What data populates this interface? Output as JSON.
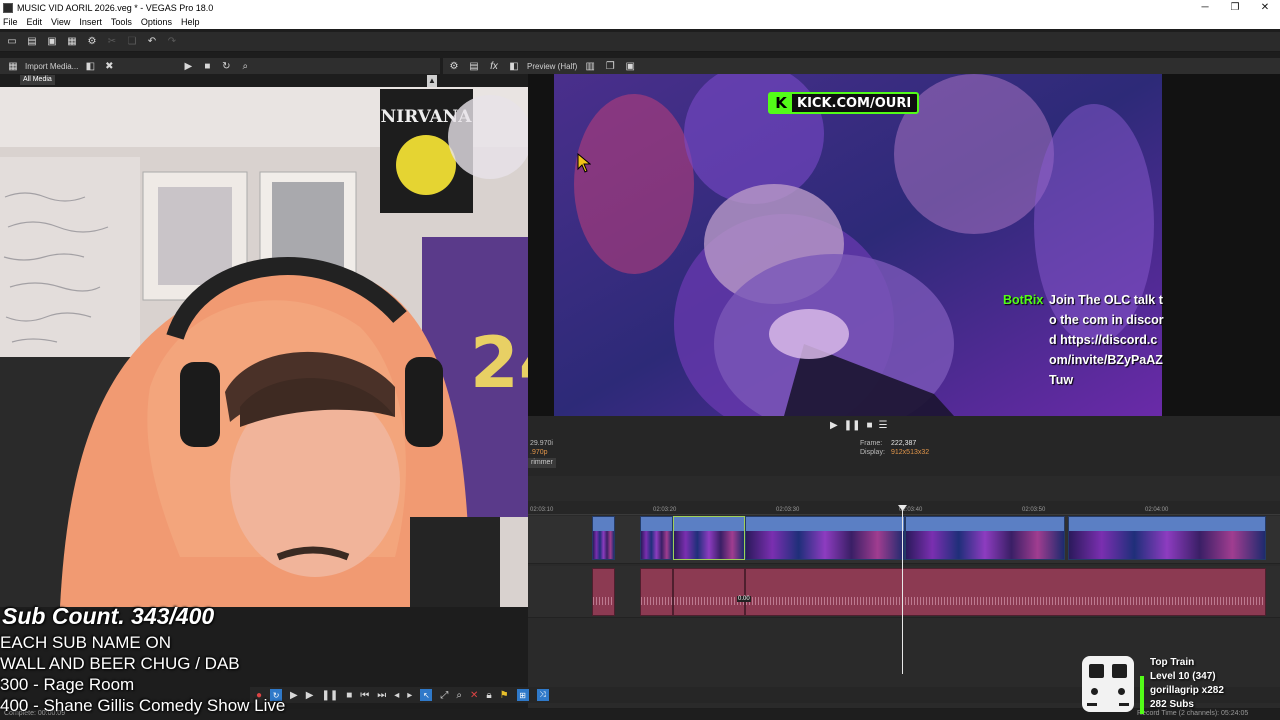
{
  "window": {
    "title": "MUSIC VID AORIL 2026.veg * - VEGAS Pro 18.0",
    "minimize": "─",
    "maximize": "❐",
    "close": "✕"
  },
  "menu": [
    "File",
    "Edit",
    "View",
    "Insert",
    "Tools",
    "Options",
    "Help"
  ],
  "media_panel": {
    "import_label": "Import Media...",
    "tree_item": "All Media"
  },
  "preview": {
    "quality": "Preview (Half)",
    "kick_logo": "K",
    "kick_text": "KICK.COM/OURI",
    "chat_user": "BotRix",
    "chat_message": "Join The OLC talk to the com in discord https://discord.com/invite/BZyPaAZTuw"
  },
  "preview_info": {
    "left_val_1": "29.970i",
    "left_val_2": ".970p",
    "frame_label": "Frame:",
    "frame_value": "222,387",
    "display_label": "Display:",
    "display_value": "912x513x32",
    "trimmer_tab": "rimmer"
  },
  "timeline": {
    "ticks": [
      "02:03:10",
      "02:03:20",
      "02:03:30",
      "02:03:40",
      "02:03:50",
      "02:04:00"
    ],
    "clip_label": "0.00"
  },
  "overlay": {
    "sub_count": "Sub Count. 343/400",
    "goal_line_1": "EACH SUB NAME ON",
    "goal_line_2": "WALL AND BEER CHUG / DAB",
    "goal_line_3": "300 - Rage Room",
    "goal_line_4": "400 - Shane Gillis Comedy Show Live"
  },
  "top_train": {
    "title": "Top Train",
    "level": "Level 10 (347)",
    "top_user": "gorillagrip x282",
    "subs": "282 Subs"
  },
  "status": {
    "left": "Complete: 00:00:09",
    "right": "Record Time (2 channels): 05:24:05"
  },
  "colors": {
    "kick_green": "#53fc18",
    "video_clip": "#4a6aa8",
    "audio_clip": "#8c3a52",
    "accent_orange": "#e0954a"
  }
}
